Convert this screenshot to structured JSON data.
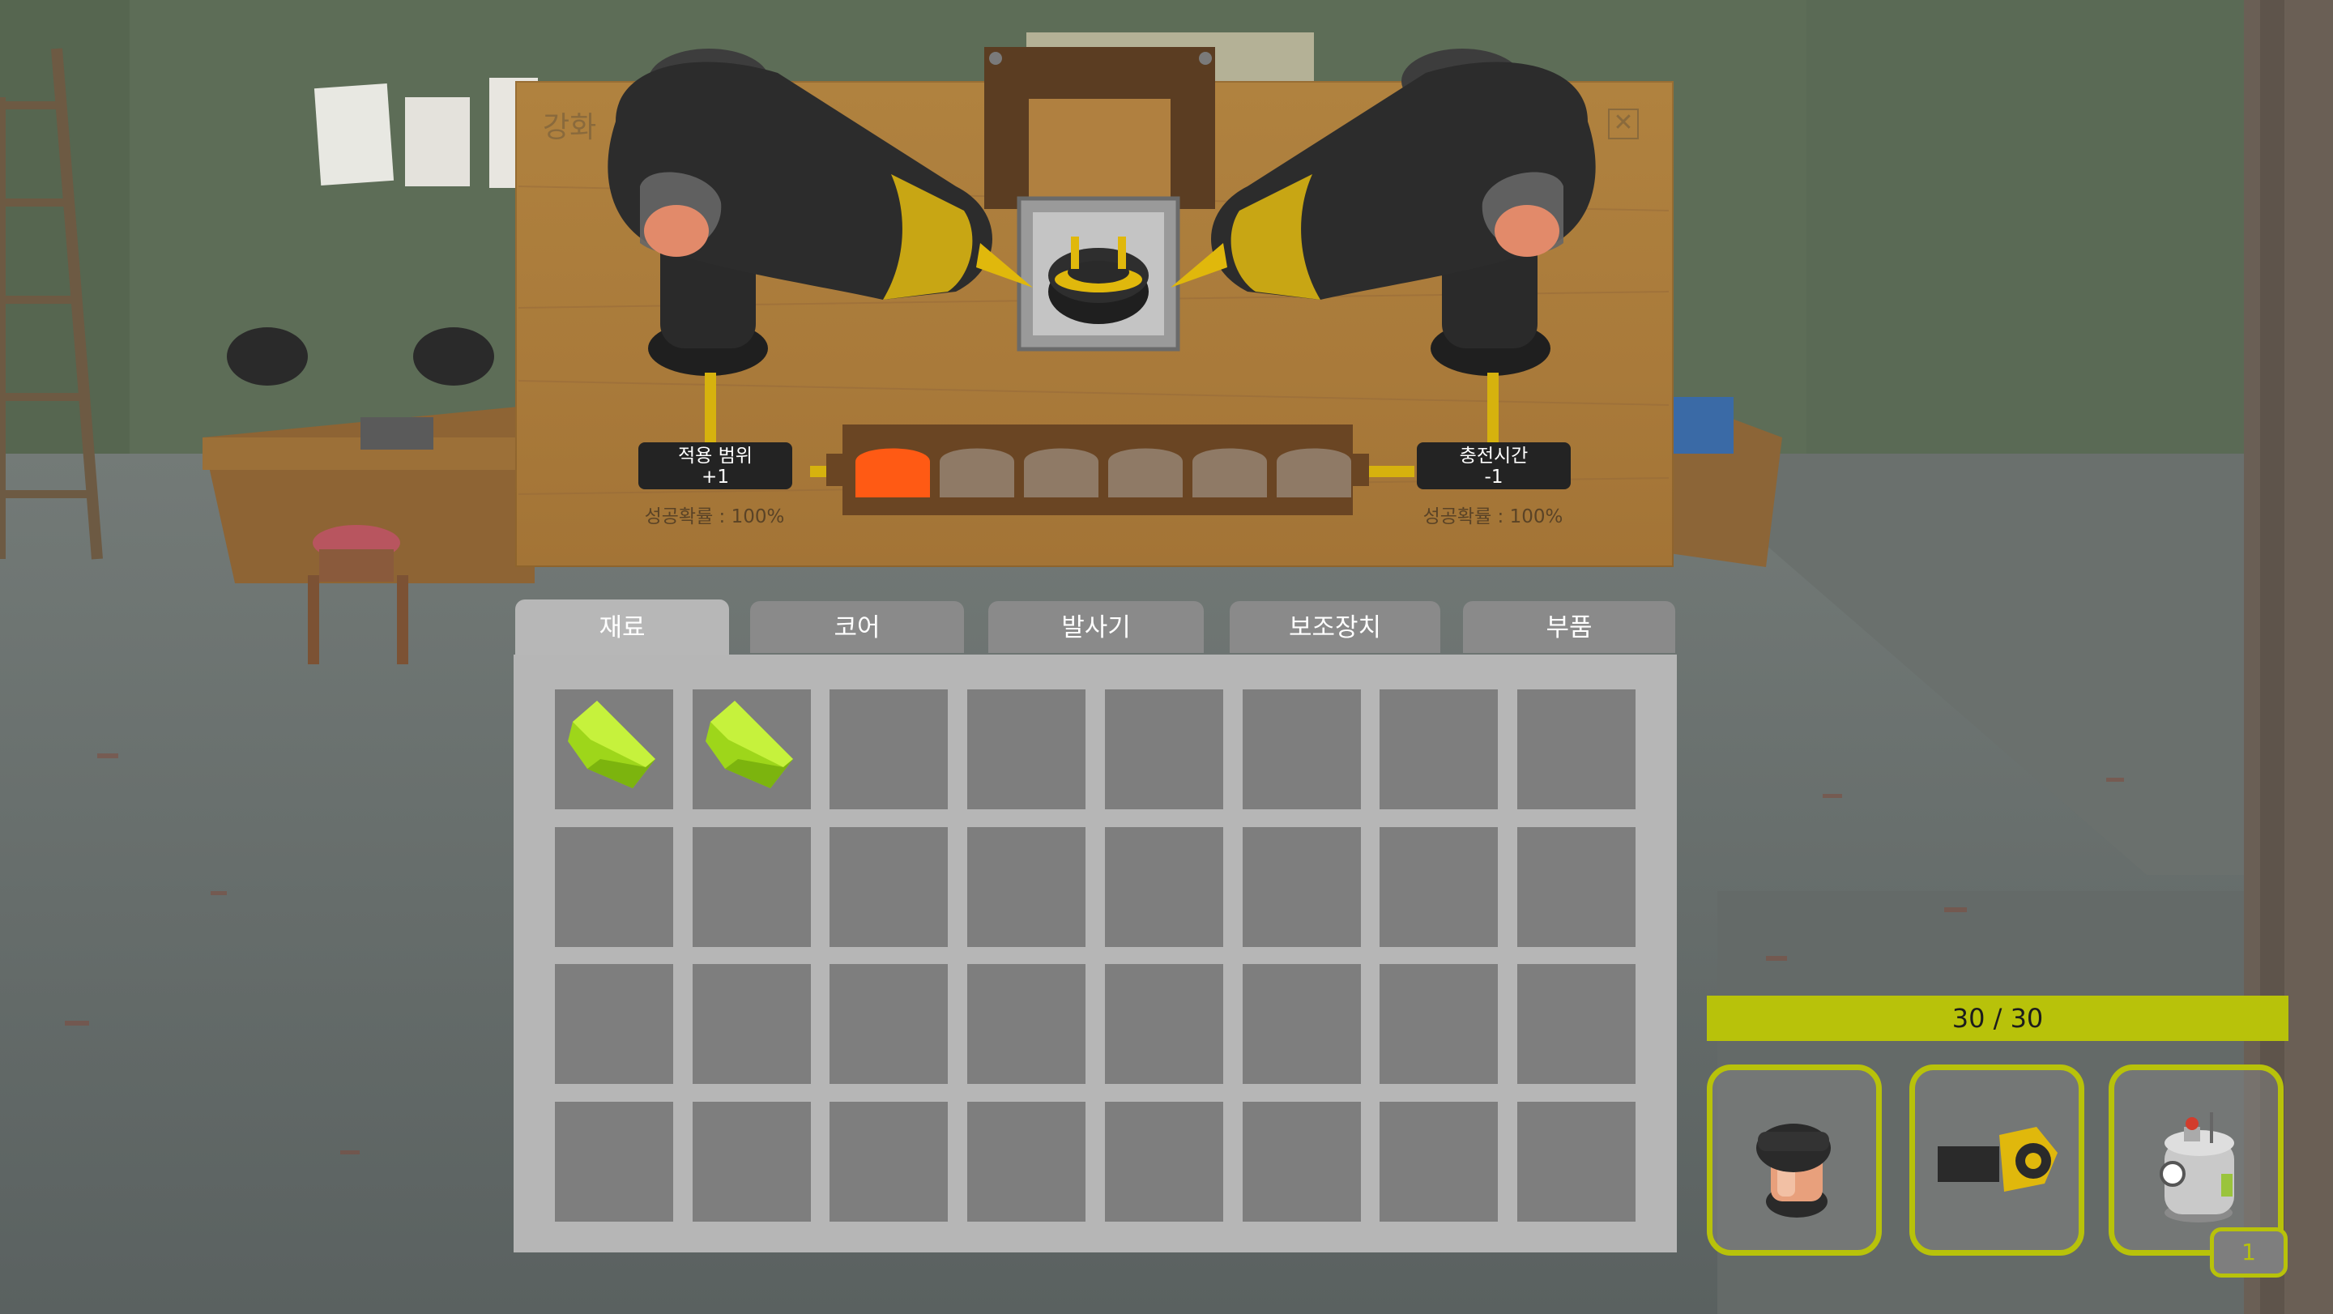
{
  "panel": {
    "title": "강화",
    "close_icon": "close-icon",
    "left_stat": {
      "label": "적용 범위",
      "value": "+1",
      "probability": "성공확률 : 100%"
    },
    "right_stat": {
      "label": "충전시간",
      "value": "-1",
      "probability": "성공확률 : 100%"
    },
    "upgrade_slots": {
      "total": 6,
      "filled": 1,
      "filled_color": "#ff5a14",
      "empty_color": "#8f7a66"
    }
  },
  "tabs": [
    {
      "label": "재료",
      "active": true
    },
    {
      "label": "코어",
      "active": false
    },
    {
      "label": "발사기",
      "active": false
    },
    {
      "label": "보조장치",
      "active": false
    },
    {
      "label": "부품",
      "active": false
    }
  ],
  "inventory": {
    "rows": 4,
    "cols": 8,
    "items": [
      "green-crystal-icon",
      "green-crystal-icon"
    ]
  },
  "hud": {
    "health": "30 / 30",
    "accent_color": "#b8c20a",
    "quick_slots": [
      "core-icon",
      "launcher-icon",
      "auxiliary-device-icon"
    ],
    "item_count": "1"
  }
}
